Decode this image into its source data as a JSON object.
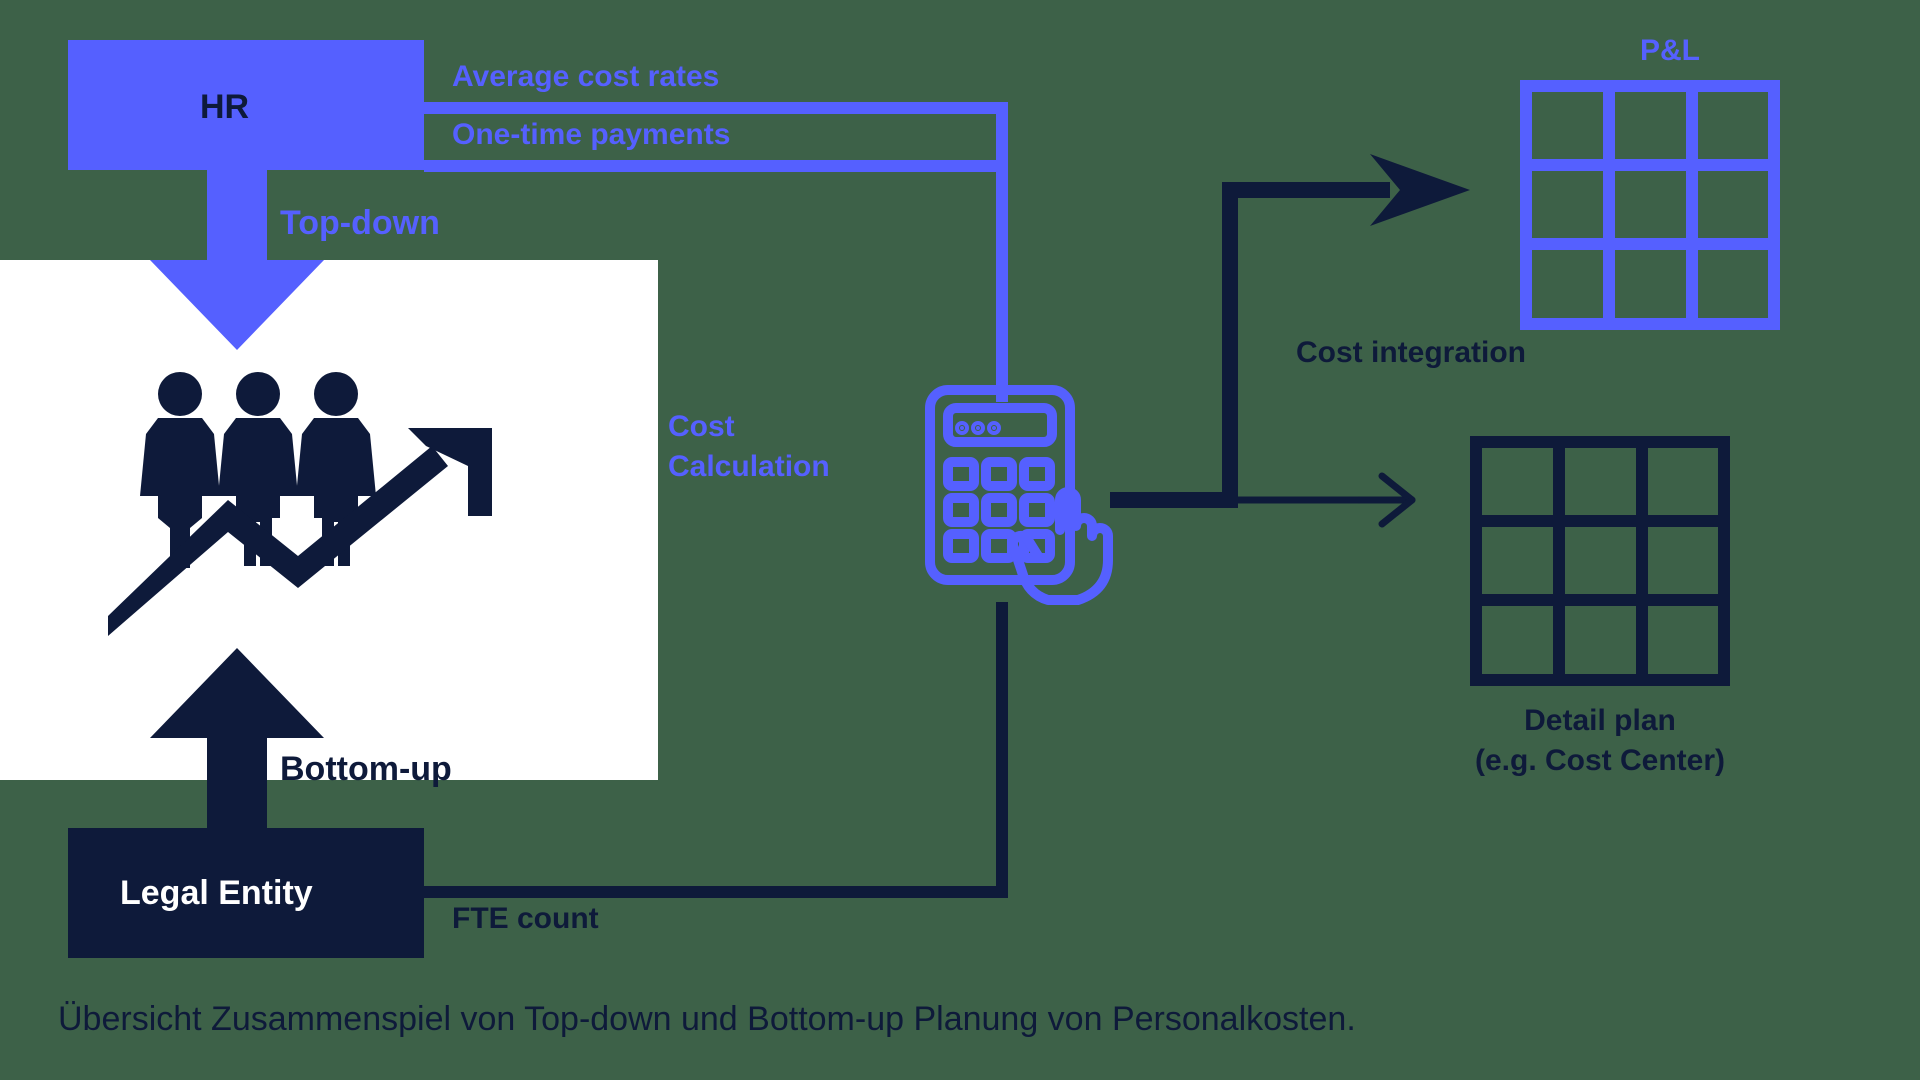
{
  "hr_block": {
    "title": "HR",
    "output1": "Average cost rates",
    "output2": "One-time payments",
    "direction": "Top-down"
  },
  "legal_block": {
    "title": "Legal Entity",
    "output": "FTE count",
    "direction": "Bottom-up"
  },
  "calc": {
    "label1": "Cost",
    "label2": "Calculation"
  },
  "integration": {
    "label": "Cost integration"
  },
  "pl": {
    "label": "P&L"
  },
  "detail": {
    "line1": "Detail plan",
    "line2": "(e.g. Cost Center)"
  },
  "caption": "Übersicht Zusammenspiel von Top-down und Bottom-up Planung von Personalkosten.",
  "colors": {
    "indigo": "#5560ff",
    "navy": "#0e1a3a",
    "bg": "#3d6148"
  }
}
